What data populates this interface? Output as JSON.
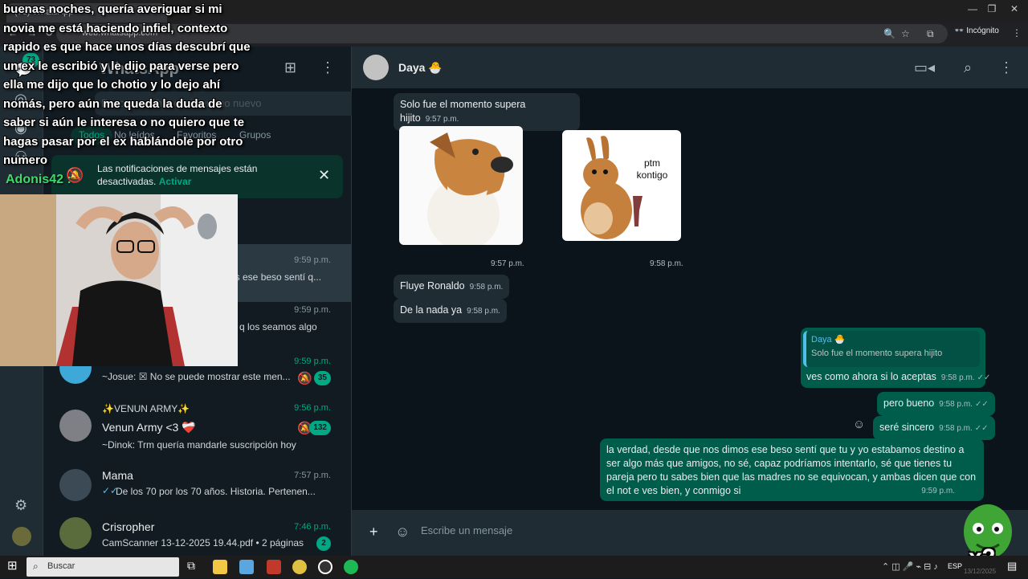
{
  "browser": {
    "tab_title": "(73) WhatsApp",
    "url": "web.whatsapp.com",
    "incognito_label": "Incógnito"
  },
  "sidebar": {
    "title": "WhatsApp",
    "unread_rail_count": "73",
    "search_placeholder": "Buscar un chat o iniciar uno nuevo",
    "filters": [
      "Todos",
      "No leídos",
      "Favoritos",
      "Grupos"
    ],
    "notification": {
      "text": "Las notificaciones de mensajes están desactivadas.",
      "link": "Activar"
    },
    "chats": [
      {
        "name": "",
        "time": "9:59 p.m.",
        "preview": "os ese beso sentí q...",
        "unread": ""
      },
      {
        "name": "",
        "time": "9:59 p.m.",
        "preview": "q los seamos algo",
        "unread": ""
      },
      {
        "name": "",
        "time": "9:59 p.m.",
        "preview": "~Josue: ☒ No se puede mostrar este men...",
        "unread": "35"
      },
      {
        "name": "✨VENUN ARMY✨",
        "subname": "Venun Army <3 ❤️‍🩹",
        "time": "9:56 p.m.",
        "preview": "~Dinok: Trm quería mandarle suscripción hoy",
        "unread": "132"
      },
      {
        "name": "Mama",
        "time": "7:57 p.m.",
        "preview": "De los 70 por los 70 años. Historia. Pertenen...",
        "unread": ""
      },
      {
        "name": "Crisropher",
        "time": "7:46 p.m.",
        "preview": "CamScanner 13-12-2025 19.44.pdf • 2 páginas",
        "unread": "2"
      }
    ]
  },
  "chat": {
    "contact_name": "Daya 🐣",
    "messages": {
      "m1": {
        "text": "Solo fue el momento supera hijito",
        "time": "9:57 p.m."
      },
      "sticker1_time": "9:57 p.m.",
      "sticker2_time": "9:58 p.m.",
      "sticker2_text": "ptm\nkontigo",
      "m2": {
        "text": "Fluye Ronaldo",
        "time": "9:58 p.m."
      },
      "m3": {
        "text": "De la nada ya",
        "time": "9:58 p.m."
      },
      "quote_author": "Daya 🐣",
      "quote_text": "Solo fue el momento supera hijito",
      "m4": {
        "text": "ves como ahora si lo aceptas",
        "time": "9:58 p.m."
      },
      "m5": {
        "text": "pero bueno",
        "time": "9:58 p.m."
      },
      "m6": {
        "text": "seré sincero",
        "time": "9:58 p.m."
      },
      "m7": {
        "text": "la verdad, desde que nos dimos ese beso sentí que tu y yo estabamos destino a ser algo más que amigos, no sé, capaz podríamos intentarlo, sé que tienes tu pareja pero tu sabes bien que las madres no se equivocan, y ambas dicen que con el not e ves bien, y conmigo si",
        "time": "9:59 p.m."
      }
    },
    "composer_placeholder": "Escribe un mensaje"
  },
  "taskbar": {
    "search_label": "Buscar",
    "lang": "ESP",
    "date": "13/12/2025"
  },
  "overlay": {
    "question": "buenas noches, quería averiguar si mi novia me está haciendo infiel, contexto rapido es que hace unos días descubrí que un ex le escribió y le dijo para verse pero ella me dijo que lo chotio y lo dejo ahí nomás, pero aún me queda la duda de saber si aún le interesa o no quiero que te hagas pasar por el ex hablándole por otro numero",
    "username": "Adonis42 :",
    "multiplier": "x2"
  },
  "colors": {
    "accent": "#00a884",
    "outgoing_bubble": "#005c4b",
    "incoming_bubble": "#202c33"
  }
}
